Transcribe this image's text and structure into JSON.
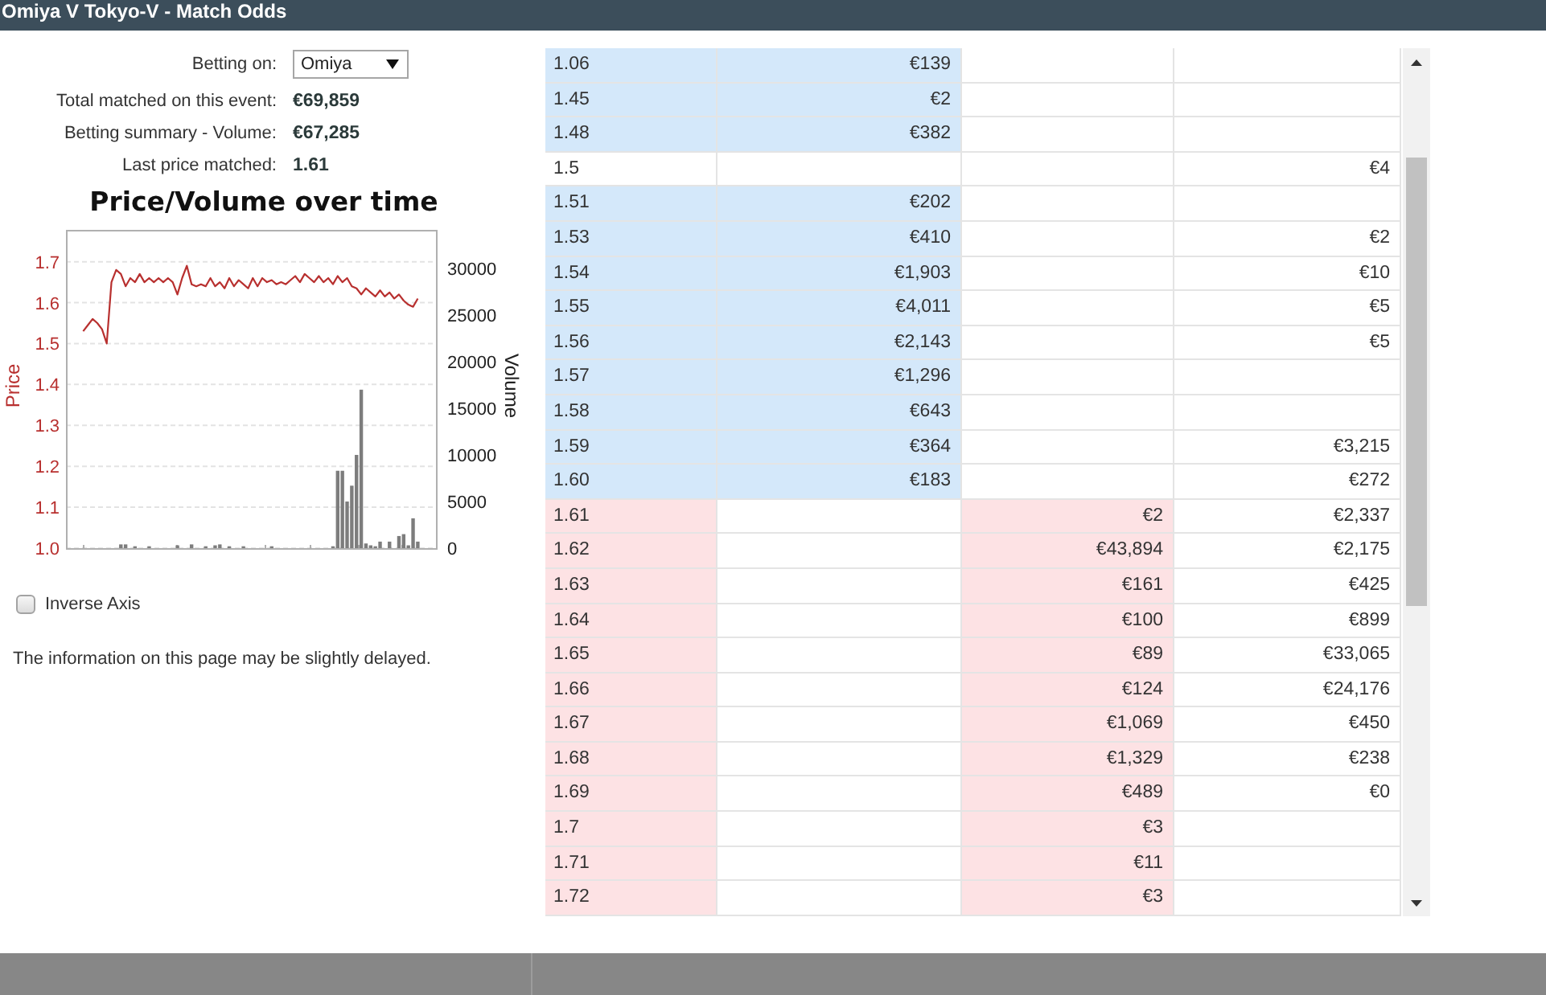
{
  "window": {
    "title": "Omiya V Tokyo-V - Match Odds"
  },
  "betting_on": {
    "label": "Betting on:",
    "value": "Omiya"
  },
  "stats": [
    {
      "label": "Total matched on this event:",
      "value": "€69,859"
    },
    {
      "label": "Betting summary - Volume:",
      "value": "€67,285"
    },
    {
      "label": "Last price matched:",
      "value": "1.61"
    }
  ],
  "chart": {
    "chart_data": {
      "type": "line",
      "title": "Price/Volume over time",
      "ylabel": "Price",
      "y2label": "Volume",
      "grid": true,
      "ylim": [
        1.0,
        1.77
      ],
      "yticks": [
        {
          "value": 1,
          "label": "1.0"
        },
        1.1,
        1.2,
        1.3,
        1.4,
        1.5,
        1.6,
        1.7
      ],
      "y2lim": [
        0,
        33800
      ],
      "y2ticks": [
        0,
        5000,
        10000,
        15000,
        20000,
        25000,
        30000
      ],
      "series": [
        {
          "color": "#b8302f",
          "values": [
            1.53,
            1.545,
            1.56,
            1.55,
            1.535,
            1.5,
            1.65,
            1.68,
            1.67,
            1.64,
            1.66,
            1.65,
            1.67,
            1.65,
            1.66,
            1.65,
            1.66,
            1.65,
            1.66,
            1.65,
            1.62,
            1.66,
            1.69,
            1.645,
            1.64,
            1.645,
            1.64,
            1.66,
            1.64,
            1.65,
            1.635,
            1.66,
            1.64,
            1.655,
            1.645,
            1.635,
            1.66,
            1.64,
            1.66,
            1.65,
            1.655,
            1.645,
            1.65,
            1.645,
            1.655,
            1.665,
            1.65,
            1.67,
            1.66,
            1.65,
            1.665,
            1.65,
            1.66,
            1.645,
            1.665,
            1.65,
            1.66,
            1.64,
            1.635,
            1.62,
            1.635,
            1.625,
            1.615,
            1.63,
            1.615,
            1.625,
            1.61,
            1.62,
            1.605,
            1.595,
            1.59,
            1.61
          ]
        },
        {
          "type": "bar",
          "axis": "y2",
          "color": "#7d7d7d",
          "values": [
            null,
            null,
            null,
            null,
            null,
            null,
            null,
            null,
            400,
            400,
            null,
            200,
            null,
            null,
            200,
            null,
            null,
            null,
            null,
            null,
            300,
            null,
            null,
            400,
            null,
            null,
            200,
            null,
            300,
            400,
            null,
            200,
            null,
            null,
            200,
            null,
            null,
            null,
            null,
            null,
            200,
            null,
            null,
            null,
            null,
            null,
            null,
            null,
            null,
            null,
            null,
            null,
            null,
            200,
            8300,
            8300,
            5000,
            6700,
            10000,
            17000,
            500,
            300,
            200,
            700,
            null,
            700,
            null,
            1300,
            1500,
            300,
            3200,
            700
          ]
        }
      ]
    }
  },
  "inverse_axis": {
    "label": "Inverse Axis",
    "checked": false
  },
  "notice": "The information on this page may be slightly delayed.",
  "ladder": {
    "rows": [
      {
        "kind": "back",
        "column_1": "1.06",
        "column_2": "€139"
      },
      {
        "kind": "back",
        "column_1": "1.45",
        "column_2": "€2"
      },
      {
        "kind": "back",
        "column_1": "1.48",
        "column_2": "€382"
      },
      {
        "kind": "plain",
        "column_1": "1.5",
        "column_4": "€4"
      },
      {
        "kind": "back",
        "column_1": "1.51",
        "column_2": "€202"
      },
      {
        "kind": "back",
        "column_1": "1.53",
        "column_2": "€410",
        "column_4": "€2"
      },
      {
        "kind": "back",
        "column_1": "1.54",
        "column_2": "€1,903",
        "column_4": "€10"
      },
      {
        "kind": "back",
        "column_1": "1.55",
        "column_2": "€4,011",
        "column_4": "€5"
      },
      {
        "kind": "back",
        "column_1": "1.56",
        "column_2": "€2,143",
        "column_4": "€5"
      },
      {
        "kind": "back",
        "column_1": "1.57",
        "column_2": "€1,296"
      },
      {
        "kind": "back",
        "column_1": "1.58",
        "column_2": "€643"
      },
      {
        "kind": "back",
        "column_1": "1.59",
        "column_2": "€364",
        "column_4": "€3,215"
      },
      {
        "kind": "back",
        "column_1": "1.60",
        "column_2": "€183",
        "column_4": "€272"
      },
      {
        "kind": "lay",
        "column_1": "1.61",
        "column_3": "€2",
        "column_4": "€2,337"
      },
      {
        "kind": "lay",
        "column_1": "1.62",
        "column_3": "€43,894",
        "column_4": "€2,175"
      },
      {
        "kind": "lay",
        "column_1": "1.63",
        "column_3": "€161",
        "column_4": "€425"
      },
      {
        "kind": "lay",
        "column_1": "1.64",
        "column_3": "€100",
        "column_4": "€899"
      },
      {
        "kind": "lay",
        "column_1": "1.65",
        "column_3": "€89",
        "column_4": "€33,065"
      },
      {
        "kind": "lay",
        "column_1": "1.66",
        "column_3": "€124",
        "column_4": "€24,176"
      },
      {
        "kind": "lay",
        "column_1": "1.67",
        "column_3": "€1,069",
        "column_4": "€450"
      },
      {
        "kind": "lay",
        "column_1": "1.68",
        "column_3": "€1,329",
        "column_4": "€238"
      },
      {
        "kind": "lay",
        "column_1": "1.69",
        "column_3": "€489",
        "column_4": "€0"
      },
      {
        "kind": "lay",
        "column_1": "1.7",
        "column_3": "€3"
      },
      {
        "kind": "lay",
        "column_1": "1.71",
        "column_3": "€11"
      },
      {
        "kind": "lay",
        "column_1": "1.72",
        "column_3": "€3"
      }
    ]
  }
}
